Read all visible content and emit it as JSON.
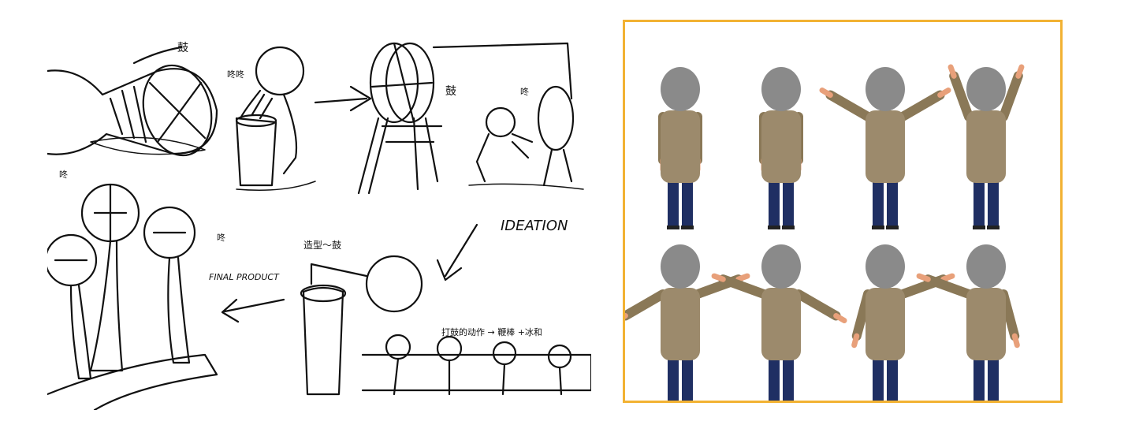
{
  "sketch": {
    "label_drum_top": "鼓",
    "label_sound_1": "咚咚",
    "label_drum_right": "鼓",
    "label_sound_2": "咚",
    "label_sound_3": "咚",
    "label_sound_4": "咚",
    "ideation": "IDEATION",
    "final_product": "FINAL PRODUCT",
    "shape_drum": "造型～鼓",
    "action_note": "打鼓的动作 → 鞭棒 +冰和"
  },
  "poses": {
    "count": 8,
    "colors": {
      "frame": "#f2b233",
      "head": "#8a8a8a",
      "shirt": "#9c8a6c",
      "shirt_shadow": "#8a7857",
      "pants": "#1f2f63",
      "skin": "#e8a07a",
      "shoe": "#222222"
    }
  }
}
